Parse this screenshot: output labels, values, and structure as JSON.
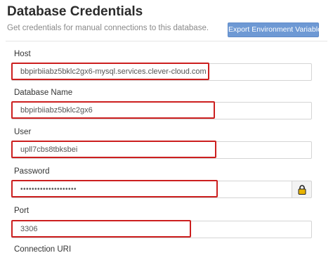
{
  "header": {
    "title": "Database Credentials",
    "subtitle": "Get credentials for manual connections to this database.",
    "export_button": "Export Environment Variables"
  },
  "fields": {
    "host": {
      "label": "Host",
      "value": "bbpirbiiabz5bklc2gx6-mysql.services.clever-cloud.com"
    },
    "database_name": {
      "label": "Database Name",
      "value": "bbpirbiiabz5bklc2gx6"
    },
    "user": {
      "label": "User",
      "value": "upll7cbs8tbksbei"
    },
    "password": {
      "label": "Password",
      "value": "••••••••••••••••••••"
    },
    "port": {
      "label": "Port",
      "value": "3306"
    },
    "connection_uri": {
      "label": "Connection URI"
    }
  },
  "icons": {
    "reveal_password": "lock-icon"
  },
  "colors": {
    "accent": "#6e99d4",
    "highlight": "#cc1f1f",
    "lock": "#e8b400"
  }
}
